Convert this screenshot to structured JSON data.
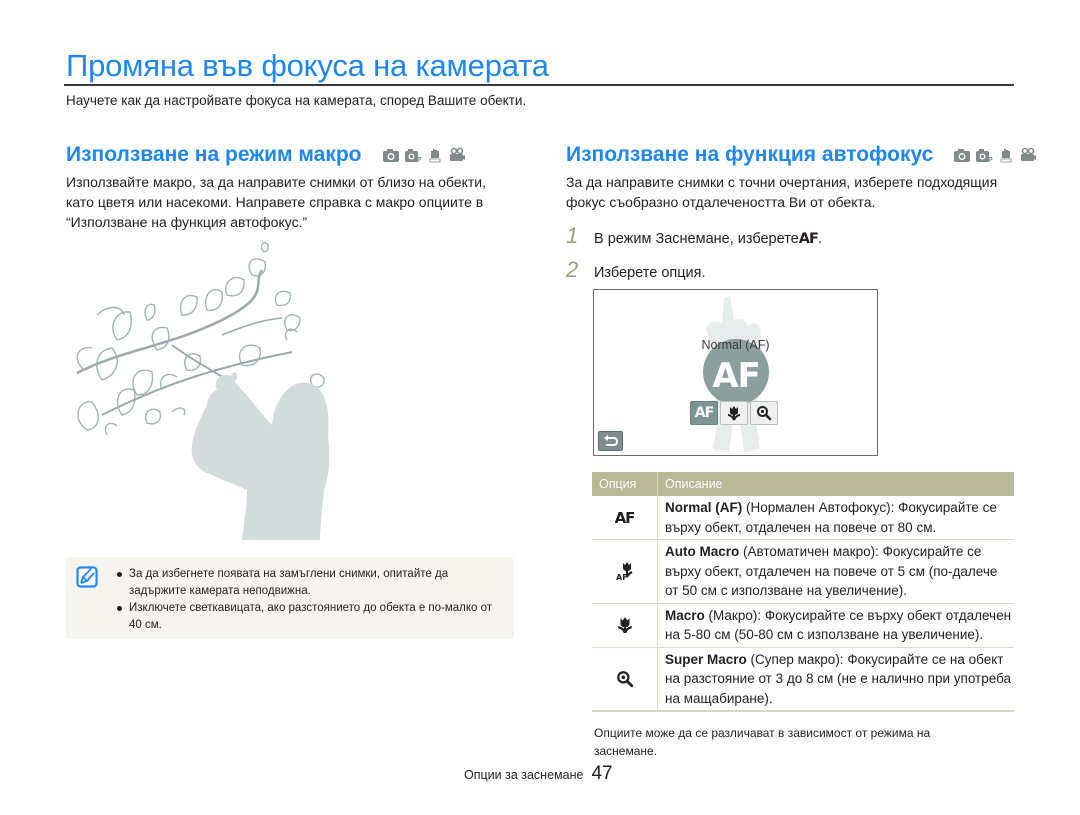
{
  "page": {
    "title": "Промяна във фокуса на камерата",
    "intro": "Научете как да настройвате фокуса на камерата, според Вашите обекти."
  },
  "macro_section": {
    "heading": "Използване на режим макро",
    "mode_icons": [
      "camera-auto-icon",
      "camera-program-icon",
      "dual-is-icon",
      "movie-icon"
    ],
    "body": "Използвайте макро, за да направите снимки от близо на обекти, като цветя или насекоми. Направете справка с макро опциите в “Използване на функция автофокус.”",
    "illustration": "woman-photographing-magnolia-branch",
    "note": {
      "icon": "note-pencil-icon",
      "items": [
        "За да избегнете появата на замъглени снимки, опитайте да задържите камерата неподвижна.",
        "Изключете светкавицата, ако разстоянието до обекта е по-малко от 40 см."
      ]
    }
  },
  "af_section": {
    "heading": "Използване на функция автофокус",
    "mode_icons": [
      "camera-auto-icon",
      "camera-program-icon",
      "dual-is-icon",
      "movie-icon"
    ],
    "body": "За да направите снимки с точни очертания, изберете подходящия фокус съобразно отдалечеността Ви от обекта.",
    "steps": [
      {
        "num": "1",
        "text": "В режим Заснемане, изберете ",
        "glyph": "AF",
        "suffix": "."
      },
      {
        "num": "2",
        "text": "Изберете опция."
      }
    ],
    "screen": {
      "label": "Normal (AF)",
      "big_icon": "AF",
      "options": [
        {
          "name": "af-normal",
          "glyph": "AF",
          "selected": true
        },
        {
          "name": "macro",
          "glyph": "flower",
          "selected": false
        },
        {
          "name": "super-macro",
          "glyph": "magnifier",
          "selected": false
        }
      ],
      "back_icon": "back-arrow-icon"
    },
    "table": {
      "headers": [
        "Опция",
        "Описание"
      ],
      "rows": [
        {
          "icon": "af-normal-icon",
          "name": "Normal (AF)",
          "desc": " (Нормален Автофокус): Фокусирайте се върху обект, отдалечен на повече от 80 см."
        },
        {
          "icon": "auto-macro-icon",
          "name": "Auto Macro",
          "desc": " (Автоматичен макро): Фокусирайте се върху обект, отдалечен на повече от 5 см (по-далече от 50 см с използване на увеличение)."
        },
        {
          "icon": "macro-icon",
          "name": "Macro",
          "desc": " (Макро): Фокусирайте се върху обект отдалечен на 5-80 см (50-80 см с използване на увеличение)."
        },
        {
          "icon": "super-macro-icon",
          "name": "Super Macro",
          "desc": " (Супер макро): Фокусирайте се на обект на разстояние от 3 до 8 см (не е налично при употреба на мащабиране)."
        }
      ],
      "note": "Опциите може да се различават в зависимост от режима на заснемане."
    }
  },
  "footer": {
    "section": "Опции за заснемане",
    "page_number": "47"
  },
  "colors": {
    "accent": "#1e87f0",
    "table_header": "#b8b896",
    "step_number": "#9aa07a",
    "note_bg": "#f6f4ef"
  }
}
